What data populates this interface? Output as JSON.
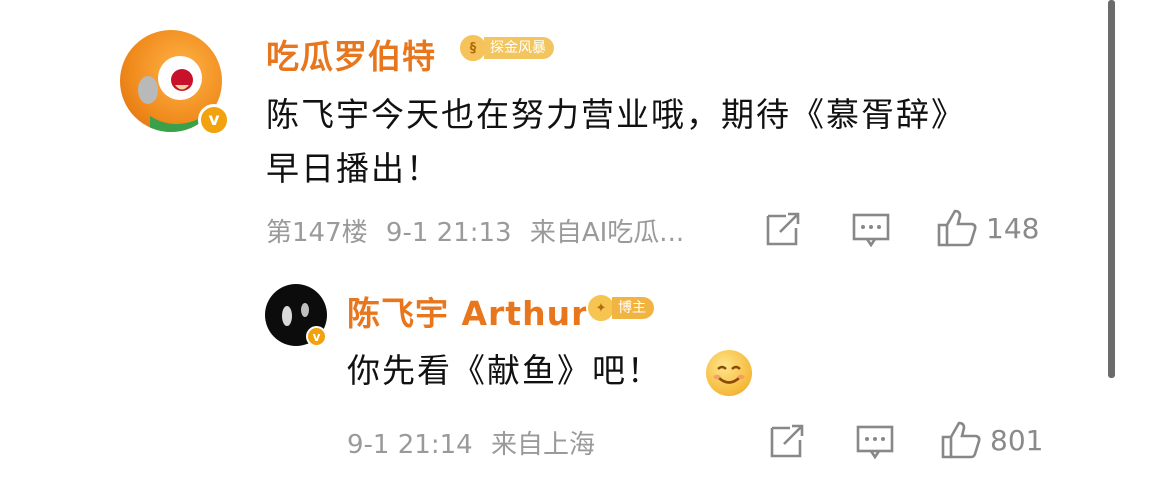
{
  "comments": [
    {
      "username": "吃瓜罗伯特",
      "tag": "探金风暴",
      "text_line1": "陈飞宇今天也在努力营业哦，期待《慕胥辞》",
      "text_line2": "早日播出！",
      "floor": "第147楼",
      "time": "9-1 21:13",
      "source": "来自AI吃瓜...",
      "likes": "148"
    },
    {
      "username": "陈飞宇 Arthur",
      "tag": "博主",
      "text": "你先看《献鱼》吧！",
      "time": "9-1 21:14",
      "source": "来自上海",
      "likes": "801"
    }
  ],
  "icons": {
    "share": "share-icon",
    "reply": "comment-icon",
    "like": "thumbs-up-icon",
    "verified": "verified-v-icon",
    "emoji": "smile-emoji"
  },
  "colors": {
    "username": "#e8761d",
    "meta": "#9a9a9a",
    "badge": "#f1a20d"
  }
}
